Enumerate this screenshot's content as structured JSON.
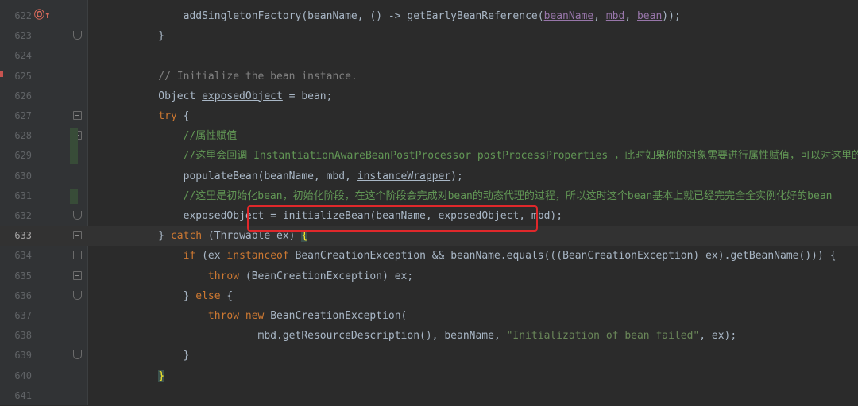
{
  "editor": {
    "lines": [
      {
        "num": "622",
        "code_parts": [
          {
            "t": "        addSingletonFactory(beanName, () -> getEarlyBeanReference(",
            "c": ""
          },
          {
            "t": "beanName",
            "c": "fld ul"
          },
          {
            "t": ", ",
            "c": ""
          },
          {
            "t": "mbd",
            "c": "fld ul"
          },
          {
            "t": ", ",
            "c": ""
          },
          {
            "t": "bean",
            "c": "fld ul"
          },
          {
            "t": "));",
            "c": ""
          }
        ]
      },
      {
        "num": "623",
        "code_parts": [
          {
            "t": "    }",
            "c": ""
          }
        ]
      },
      {
        "num": "624",
        "code_parts": []
      },
      {
        "num": "625",
        "code_parts": [
          {
            "t": "    // Initialize the bean instance.",
            "c": "cmt-gray"
          }
        ]
      },
      {
        "num": "626",
        "code_parts": [
          {
            "t": "    Object ",
            "c": ""
          },
          {
            "t": "exposedObject",
            "c": "ul"
          },
          {
            "t": " = bean;",
            "c": ""
          }
        ]
      },
      {
        "num": "627",
        "code_parts": [
          {
            "t": "    ",
            "c": ""
          },
          {
            "t": "try",
            "c": "kw"
          },
          {
            "t": " {",
            "c": ""
          }
        ]
      },
      {
        "num": "628",
        "code_parts": [
          {
            "t": "        //属性赋值",
            "c": "cmt"
          }
        ]
      },
      {
        "num": "629",
        "code_parts": [
          {
            "t": "        //这里会回调 InstantiationAwareBeanPostProcessor postProcessProperties ，此时如果你的对象需要进行属性赋值，可以对这里的",
            "c": "cmt"
          }
        ]
      },
      {
        "num": "630",
        "code_parts": [
          {
            "t": "        populateBean(beanName, mbd, ",
            "c": ""
          },
          {
            "t": "instanceWrapper",
            "c": "ul"
          },
          {
            "t": ");",
            "c": ""
          }
        ]
      },
      {
        "num": "631",
        "code_parts": [
          {
            "t": "        //这里是初始化bean，初始化阶段，在这个阶段会完成对bean的动态代理的过程，所以这时这个bean基本上就已经完完全全实例化好的bean",
            "c": "cmt"
          }
        ]
      },
      {
        "num": "632",
        "code_parts": [
          {
            "t": "        ",
            "c": ""
          },
          {
            "t": "exposedObject",
            "c": "ul"
          },
          {
            "t": " = initializeBean(beanName, ",
            "c": ""
          },
          {
            "t": "exposedObject",
            "c": "ul"
          },
          {
            "t": ", mbd);",
            "c": ""
          }
        ]
      },
      {
        "num": "633",
        "code_parts": [
          {
            "t": "    } ",
            "c": ""
          },
          {
            "t": "catch",
            "c": "kw"
          },
          {
            "t": " (Throwable ex) ",
            "c": ""
          },
          {
            "t": "{",
            "c": "brace-match"
          }
        ]
      },
      {
        "num": "634",
        "code_parts": [
          {
            "t": "        ",
            "c": ""
          },
          {
            "t": "if",
            "c": "kw"
          },
          {
            "t": " (ex ",
            "c": ""
          },
          {
            "t": "instanceof",
            "c": "kw"
          },
          {
            "t": " BeanCreationException && beanName.equals(((BeanCreationException) ex).getBeanName())) {",
            "c": ""
          }
        ]
      },
      {
        "num": "635",
        "code_parts": [
          {
            "t": "            ",
            "c": ""
          },
          {
            "t": "throw",
            "c": "kw"
          },
          {
            "t": " (BeanCreationException) ex;",
            "c": ""
          }
        ]
      },
      {
        "num": "636",
        "code_parts": [
          {
            "t": "        } ",
            "c": ""
          },
          {
            "t": "else",
            "c": "kw"
          },
          {
            "t": " {",
            "c": ""
          }
        ]
      },
      {
        "num": "637",
        "code_parts": [
          {
            "t": "            ",
            "c": ""
          },
          {
            "t": "throw new",
            "c": "kw"
          },
          {
            "t": " BeanCreationException(",
            "c": ""
          }
        ]
      },
      {
        "num": "638",
        "code_parts": [
          {
            "t": "                    mbd.getResourceDescription(), beanName, ",
            "c": ""
          },
          {
            "t": "\"Initialization of bean failed\"",
            "c": "str"
          },
          {
            "t": ", ex);",
            "c": ""
          }
        ]
      },
      {
        "num": "639",
        "code_parts": [
          {
            "t": "        }",
            "c": ""
          }
        ]
      },
      {
        "num": "640",
        "code_parts": [
          {
            "t": "    ",
            "c": ""
          },
          {
            "t": "}",
            "c": "brace-match"
          }
        ]
      },
      {
        "num": "641",
        "code_parts": []
      }
    ],
    "current_line": "633",
    "icons": {
      "override_marker": "override-up-arrow-icon",
      "fold_marker": "fold-icon"
    },
    "colors": {
      "background": "#2b2b2b",
      "keyword": "#cc7832",
      "comment": "#629755",
      "string": "#6a8759",
      "highlight_box": "#e0282b"
    }
  }
}
